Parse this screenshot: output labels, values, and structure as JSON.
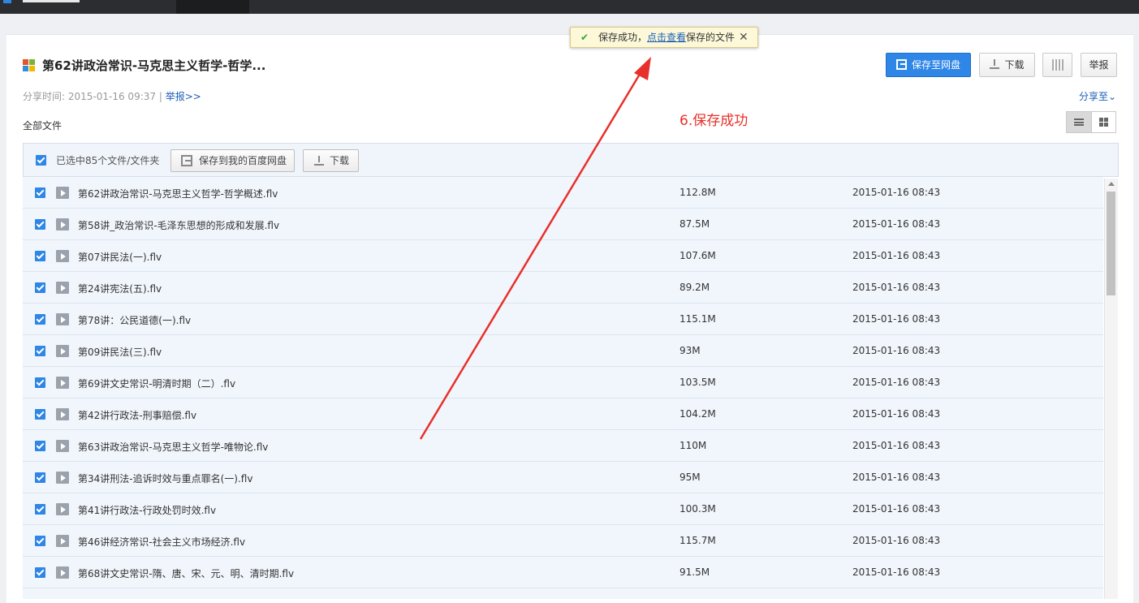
{
  "toast": {
    "prefix": "保存成功，",
    "link": "点击查看",
    "suffix": "保存的文件",
    "close": "✕"
  },
  "share": {
    "title": "第62讲政治常识-马克思主义哲学-哲学...",
    "time_label": "分享时间:",
    "time_value": "2015-01-16 09:37",
    "separator": "|",
    "report_link": "举报>>",
    "share_to": "分享至",
    "all_files": "全部文件"
  },
  "buttons": {
    "save": "保存至网盘",
    "download": "下载",
    "report": "举报"
  },
  "annotation": "6.保存成功",
  "selection": {
    "count_text": "已选中85个文件/文件夹",
    "save_button": "保存到我的百度网盘",
    "download_button": "下载"
  },
  "files": [
    {
      "name": "第62讲政治常识-马克思主义哲学-哲学概述.flv",
      "size": "112.8M",
      "time": "2015-01-16 08:43",
      "checked": true
    },
    {
      "name": "第58讲_政治常识-毛泽东思想的形成和发展.flv",
      "size": "87.5M",
      "time": "2015-01-16 08:43",
      "checked": true
    },
    {
      "name": "第07讲民法(一).flv",
      "size": "107.6M",
      "time": "2015-01-16 08:43",
      "checked": true
    },
    {
      "name": "第24讲宪法(五).flv",
      "size": "89.2M",
      "time": "2015-01-16 08:43",
      "checked": true
    },
    {
      "name": "第78讲：公民道德(一).flv",
      "size": "115.1M",
      "time": "2015-01-16 08:43",
      "checked": true
    },
    {
      "name": "第09讲民法(三).flv",
      "size": "93M",
      "time": "2015-01-16 08:43",
      "checked": true
    },
    {
      "name": "第69讲文史常识-明清时期（二）.flv",
      "size": "103.5M",
      "time": "2015-01-16 08:43",
      "checked": true
    },
    {
      "name": "第42讲行政法-刑事赔偿.flv",
      "size": "104.2M",
      "time": "2015-01-16 08:43",
      "checked": true
    },
    {
      "name": "第63讲政治常识-马克思主义哲学-唯物论.flv",
      "size": "110M",
      "time": "2015-01-16 08:43",
      "checked": true
    },
    {
      "name": "第34讲刑法-追诉时效与重点罪名(一).flv",
      "size": "95M",
      "time": "2015-01-16 08:43",
      "checked": true
    },
    {
      "name": "第41讲行政法-行政处罚时效.flv",
      "size": "100.3M",
      "time": "2015-01-16 08:43",
      "checked": true
    },
    {
      "name": "第46讲经济常识-社会主义市场经济.flv",
      "size": "115.7M",
      "time": "2015-01-16 08:43",
      "checked": true
    },
    {
      "name": "第68讲文史常识-隋、唐、宋、元、明、清时期.flv",
      "size": "91.5M",
      "time": "2015-01-16 08:43",
      "checked": true
    }
  ],
  "colors": {
    "accent": "#2e86e6",
    "annotation": "#e8302a",
    "toast_bg": "#fdf8d8",
    "row_bg": "#f1f6fc"
  },
  "icons": {
    "toast_check": "check-icon",
    "file_type": "video-file-icon",
    "view_list": "list-view-icon",
    "view_grid": "grid-view-icon",
    "qr": "qr-code-icon"
  }
}
